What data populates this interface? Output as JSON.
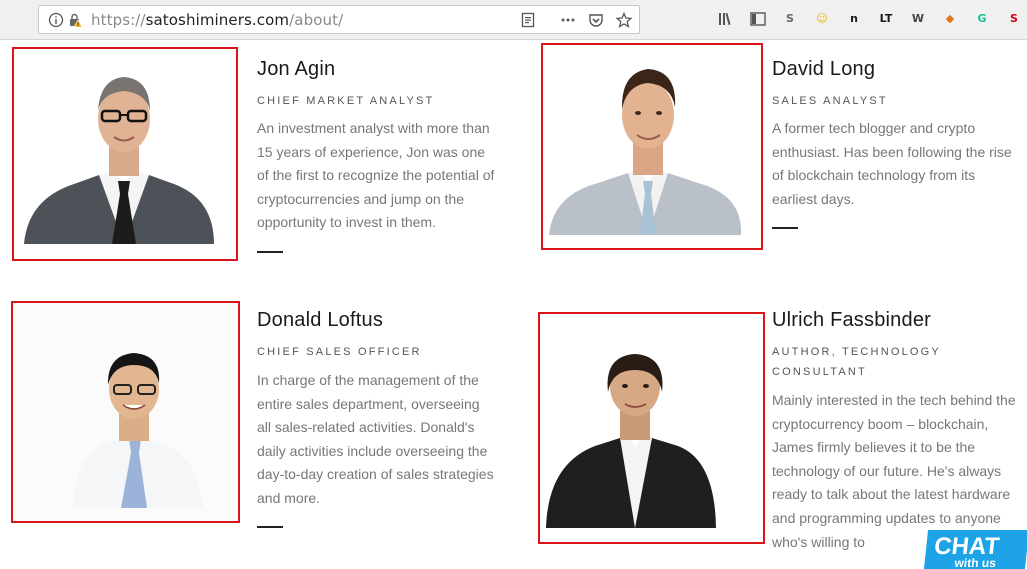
{
  "browser": {
    "url_scheme": "https://",
    "url_host": "satoshiminers.com",
    "url_path": "/about/",
    "icons": [
      "info-icon",
      "insecure-lock-icon",
      "reader-view-icon",
      "more-icon",
      "pocket-icon",
      "bookmark-star-icon",
      "library-icon",
      "sidebar-icon",
      "extension-icons"
    ],
    "extensions": [
      {
        "name": "extension-s-icon",
        "glyph": "S",
        "color": "#666666"
      },
      {
        "name": "extension-emoji-icon",
        "glyph": "☺",
        "color": "#f2b400"
      },
      {
        "name": "extension-n-icon",
        "glyph": "n",
        "color": "#1a1a1a"
      },
      {
        "name": "extension-lt-icon",
        "glyph": "LT",
        "color": "#1a1a1a"
      },
      {
        "name": "extension-w-icon",
        "glyph": "W",
        "color": "#444444"
      },
      {
        "name": "extension-fox-icon",
        "glyph": "◆",
        "color": "#e2761b"
      },
      {
        "name": "extension-grammarly-icon",
        "glyph": "G",
        "color": "#15c39a"
      },
      {
        "name": "extension-s-red-icon",
        "glyph": "S",
        "color": "#d0021b"
      }
    ]
  },
  "team": [
    {
      "name": "Jon Agin",
      "role": "Chief Market Analyst",
      "bio": "An investment analyst with more than 15 years of experience, Jon was one of the first to recognize the potential of cryptocurrencies and jump on the opportunity to invest in them."
    },
    {
      "name": "David Long",
      "role": "Sales Analyst",
      "bio": "A former tech blogger and crypto enthusiast. Has been following the rise of blockchain technology from its earliest days."
    },
    {
      "name": "Donald Loftus",
      "role": "Chief Sales Officer",
      "bio": "In charge of the management of the entire sales department, overseeing all sales-related activities. Donald's daily activities include overseeing the day-to-day creation of sales strategies and more."
    },
    {
      "name": "Ulrich Fassbinder",
      "role": "Author, Technology Consultant",
      "bio": "Mainly interested in the tech behind the cryptocurrency boom – blockchain, James firmly believes it to be the technology of our future. He's always ready to talk about the latest hardware and programming updates to anyone who's willing to"
    }
  ],
  "chat_widget": {
    "label": "CHAT",
    "sub": "with us"
  },
  "colors": {
    "highlight_border": "#d9141b",
    "chat_bg": "#1ea4e6"
  }
}
